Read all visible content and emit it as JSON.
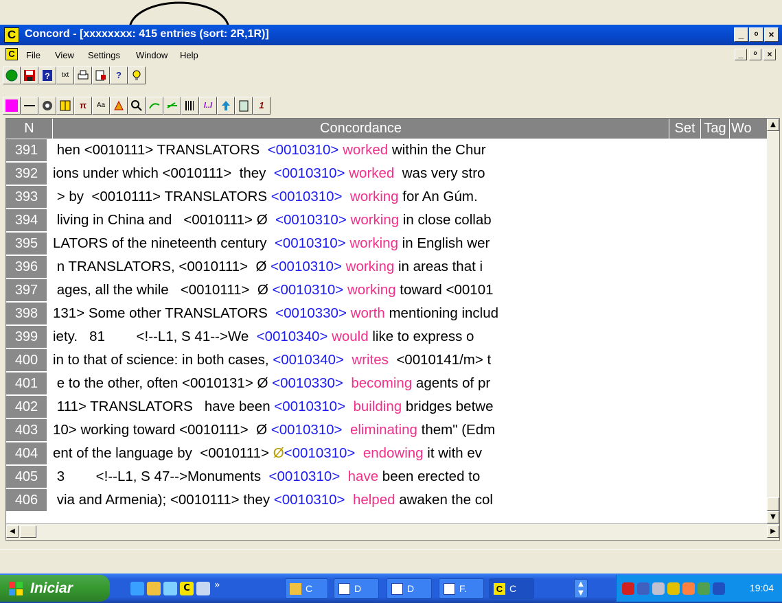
{
  "window": {
    "app_icon": "C",
    "title": "Concord - [xxxxxxxx: 415 entries (sort: 2R,1R)]",
    "controls": [
      "_",
      "ͦ",
      "×"
    ]
  },
  "menu": {
    "app_icon": "C",
    "items": [
      "File",
      "View",
      "Settings",
      "Window",
      "Help"
    ],
    "mdi_controls": [
      "_",
      "ͦ",
      "×"
    ]
  },
  "toolbar1": {
    "buttons": [
      {
        "icon": "go-green-circle-icon",
        "text": ""
      },
      {
        "icon": "save-floppy-icon",
        "text": ""
      },
      {
        "icon": "help-book-icon",
        "text": ""
      },
      {
        "icon": "txt-file-icon",
        "text": "txt"
      },
      {
        "icon": "print-icon",
        "text": ""
      },
      {
        "icon": "print-preview-icon",
        "text": ""
      },
      {
        "icon": "question-mark-icon",
        "text": "?"
      },
      {
        "icon": "lightbulb-icon",
        "text": ""
      }
    ]
  },
  "toolbar2": {
    "buttons": [
      {
        "icon": "magenta-square-icon",
        "text": ""
      },
      {
        "icon": "line-icon",
        "text": ""
      },
      {
        "icon": "gear-icon",
        "text": ""
      },
      {
        "icon": "columns-icon",
        "text": ""
      },
      {
        "icon": "pi-icon",
        "text": "π"
      },
      {
        "icon": "case-icon",
        "text": "Aa"
      },
      {
        "icon": "zap-icon",
        "text": ""
      },
      {
        "icon": "search-icon",
        "text": ""
      },
      {
        "icon": "collocate-icon",
        "text": ""
      },
      {
        "icon": "plot-icon",
        "text": ""
      },
      {
        "icon": "barcode-icon",
        "text": ""
      },
      {
        "icon": "italic-icon",
        "text": "l..l"
      },
      {
        "icon": "arrow-up-icon",
        "text": ""
      },
      {
        "icon": "clipboard-icon",
        "text": ""
      },
      {
        "icon": "one-icon",
        "text": "1"
      }
    ]
  },
  "grid": {
    "headers": [
      "N",
      "Concordance",
      "Set",
      "Tag",
      "Wo"
    ],
    "rows": [
      {
        "n": "391",
        "left": " hen <0010111> TRANSLATORS  ",
        "tag": "<0010310>",
        "mid": " ",
        "kw": "worked",
        "right": " within the Chur"
      },
      {
        "n": "392",
        "left": "ions under which <0010111>  they  ",
        "tag": "<0010310>",
        "mid": " ",
        "kw": "worked",
        "right": "  was very stro"
      },
      {
        "n": "393",
        "left": " > by  <0010111> TRANSLATORS ",
        "tag": "<0010310>",
        "mid": "  ",
        "kw": "working",
        "right": " for An Gúm."
      },
      {
        "n": "394",
        "left": " living in China and   <0010111> Ø  ",
        "tag": "<0010310>",
        "mid": " ",
        "kw": "working",
        "right": " in close collab"
      },
      {
        "n": "395",
        "left": "LATORS of the nineteenth century  ",
        "tag": "<0010310>",
        "mid": " ",
        "kw": "working",
        "right": " in English wer"
      },
      {
        "n": "396",
        "left": " n TRANSLATORS, <0010111>  Ø ",
        "tag": "<0010310>",
        "mid": " ",
        "kw": "working",
        "right": " in areas that i"
      },
      {
        "n": "397",
        "left": " ages, all the while   <0010111>  Ø ",
        "tag": "<0010310>",
        "mid": " ",
        "kw": "working",
        "right": " toward <00101"
      },
      {
        "n": "398",
        "left": "131> Some other TRANSLATORS  ",
        "tag": "<0010330>",
        "mid": " ",
        "kw": "worth",
        "right": " mentioning includ"
      },
      {
        "n": "399",
        "left": "iety.   81        <!--L1, S 41-->We  ",
        "tag": "<0010340>",
        "mid": " ",
        "kw": "would",
        "right": " like to express o"
      },
      {
        "n": "400",
        "left": "in to that of science: in both cases, ",
        "tag": "<0010340>",
        "mid": "  ",
        "kw": "writes",
        "right": "  <0010141/m> t"
      },
      {
        "n": "401",
        "left": " e to the other, often <0010131> Ø ",
        "tag": "<0010330>",
        "mid": "  ",
        "kw": "becoming",
        "right": " agents of pr"
      },
      {
        "n": "402",
        "left": " 111> TRANSLATORS   have been ",
        "tag": "<0010310>",
        "mid": "  ",
        "kw": "building",
        "right": " bridges betwe"
      },
      {
        "n": "403",
        "left": "10> working toward <0010111>  Ø ",
        "tag": "<0010310>",
        "mid": "  ",
        "kw": "eliminating",
        "right": " them\" (Edm"
      },
      {
        "n": "404",
        "left": "ent of the language by  <0010111> ",
        "ph": "Ø",
        "tag": "<0010310>",
        "mid": "  ",
        "kw": "endowing",
        "right": " it with ev"
      },
      {
        "n": "405",
        "left": " 3        <!--L1, S 47-->Monuments  ",
        "tag": "<0010310>",
        "mid": "  ",
        "kw": "have",
        "right": " been erected to"
      },
      {
        "n": "406",
        "left": " via and Armenia); <0010111> they ",
        "tag": "<0010310>",
        "mid": "  ",
        "kw": "helped",
        "right": " awaken the col"
      }
    ]
  },
  "taskbar": {
    "start_label": "Iniciar",
    "tasks": [
      {
        "icon": "folder-icon",
        "label": "C"
      },
      {
        "icon": "word-doc-icon",
        "label": "D"
      },
      {
        "icon": "word-doc-icon",
        "label": "D"
      },
      {
        "icon": "word-doc-icon",
        "label": "F."
      },
      {
        "icon": "concord-app-icon",
        "label": "C"
      }
    ],
    "chevron": "»",
    "clock": "19:04"
  }
}
